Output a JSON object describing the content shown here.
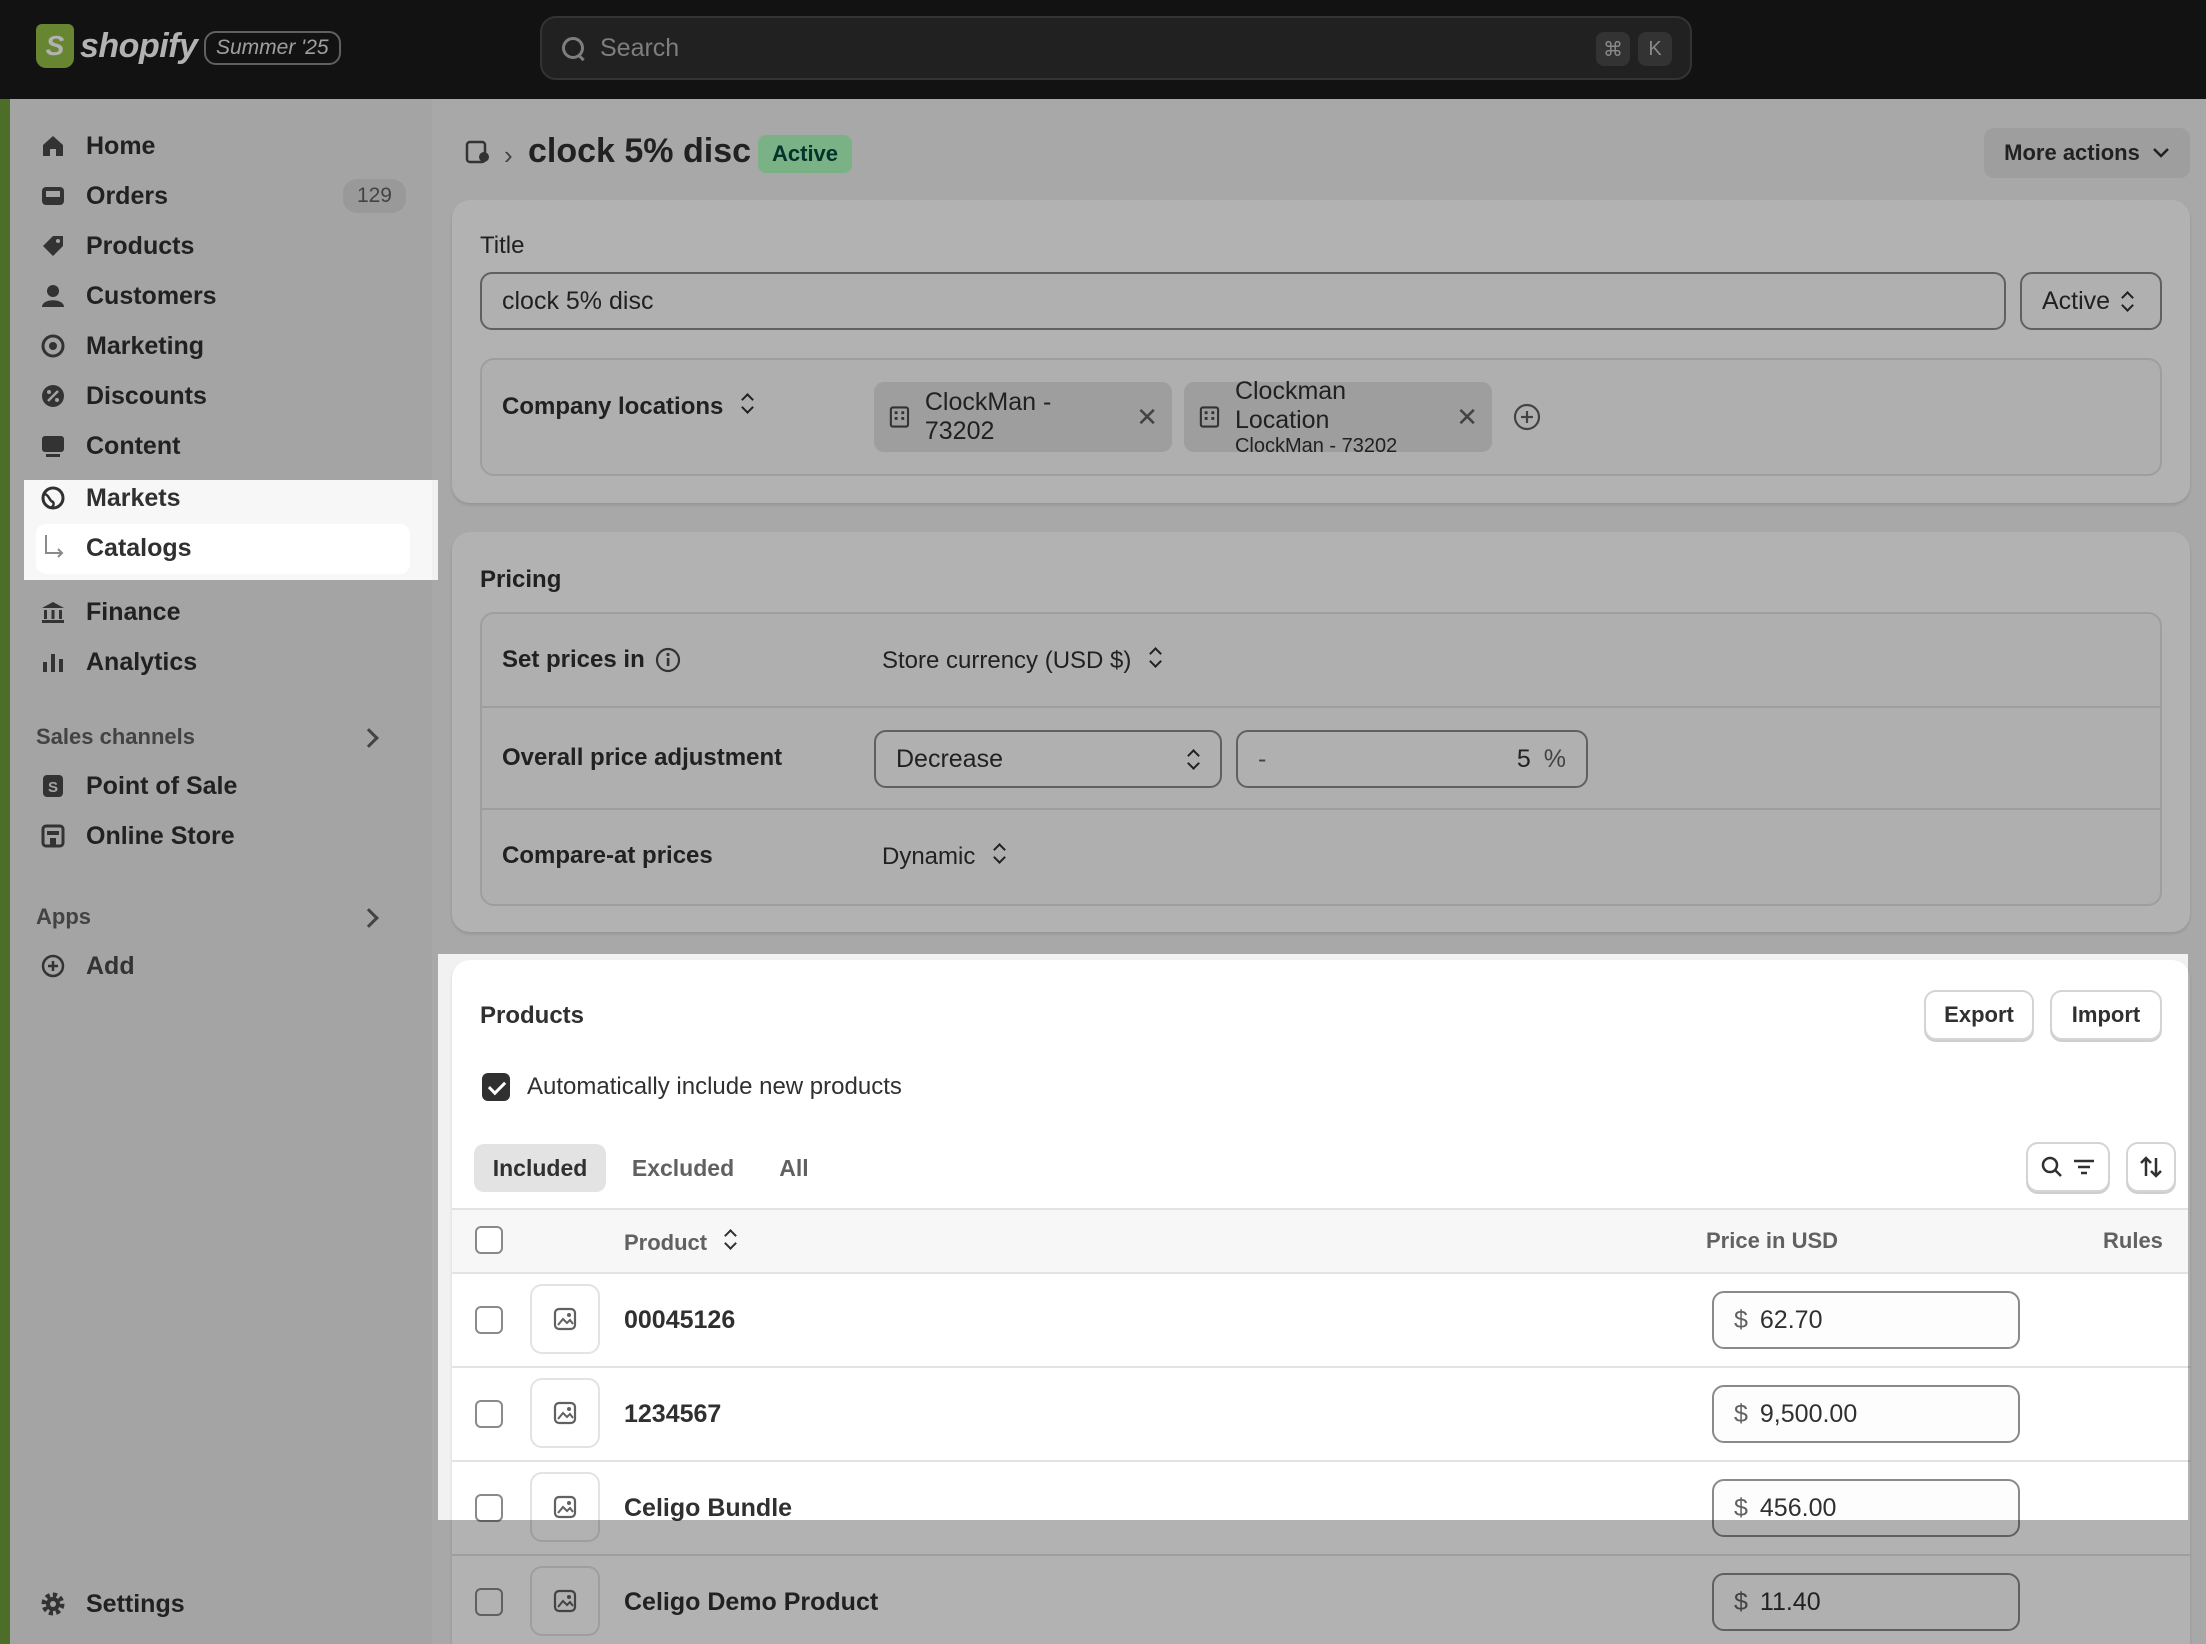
{
  "topbar": {
    "logo_mark": "S",
    "logo_text": "shopify",
    "edition": "Summer '25",
    "search_placeholder": "Search",
    "shortcut_keys": [
      "⌘",
      "K"
    ]
  },
  "sidebar": {
    "items": [
      {
        "label": "Home",
        "icon": "home-icon"
      },
      {
        "label": "Orders",
        "icon": "inbox-icon",
        "badge": "129"
      },
      {
        "label": "Products",
        "icon": "tag-icon"
      },
      {
        "label": "Customers",
        "icon": "person-icon"
      },
      {
        "label": "Marketing",
        "icon": "target-icon"
      },
      {
        "label": "Discounts",
        "icon": "discount-icon"
      },
      {
        "label": "Content",
        "icon": "image-icon"
      },
      {
        "label": "Markets",
        "icon": "globe-icon"
      },
      {
        "label": "Catalogs",
        "icon": "subitem-arrow-icon"
      },
      {
        "label": "Finance",
        "icon": "bank-icon"
      },
      {
        "label": "Analytics",
        "icon": "bar-chart-icon"
      }
    ],
    "sales_channels_label": "Sales channels",
    "channels": [
      {
        "label": "Point of Sale",
        "icon": "pos-icon"
      },
      {
        "label": "Online Store",
        "icon": "store-icon"
      }
    ],
    "apps_label": "Apps",
    "apps_add_label": "Add",
    "settings_label": "Settings"
  },
  "page": {
    "title": "clock 5% disc",
    "status_badge": "Active",
    "more_actions_label": "More actions"
  },
  "title_card": {
    "title_label": "Title",
    "title_value": "clock 5% disc",
    "status_select": "Active",
    "company_locations_label": "Company locations",
    "locations": [
      {
        "name": "ClockMan - 73202",
        "sub": ""
      },
      {
        "name": "Clockman Location",
        "sub": "ClockMan - 73202"
      }
    ]
  },
  "pricing": {
    "heading": "Pricing",
    "set_prices_label": "Set prices in",
    "set_prices_value": "Store currency (USD $)",
    "adjustment_label": "Overall price adjustment",
    "adjustment_direction": "Decrease",
    "adjustment_sign": "-",
    "adjustment_value": "5",
    "adjustment_unit": "%",
    "compare_label": "Compare-at prices",
    "compare_value": "Dynamic"
  },
  "products": {
    "heading": "Products",
    "export_label": "Export",
    "import_label": "Import",
    "auto_include_label": "Automatically include new products",
    "auto_include_checked": true,
    "tabs": [
      "Included",
      "Excluded",
      "All"
    ],
    "columns": {
      "product": "Product",
      "price": "Price in USD",
      "rules": "Rules"
    },
    "currency_symbol": "$",
    "rows": [
      {
        "name": "00045126",
        "price": "62.70"
      },
      {
        "name": "1234567",
        "price": "9,500.00"
      },
      {
        "name": "Celigo Bundle",
        "price": "456.00"
      },
      {
        "name": "Celigo Demo Product",
        "price": "11.40"
      }
    ]
  },
  "colors": {
    "accent_green": "#95bf47",
    "active_badge_bg": "#affebf",
    "topbar_bg": "#1a1a1a"
  }
}
